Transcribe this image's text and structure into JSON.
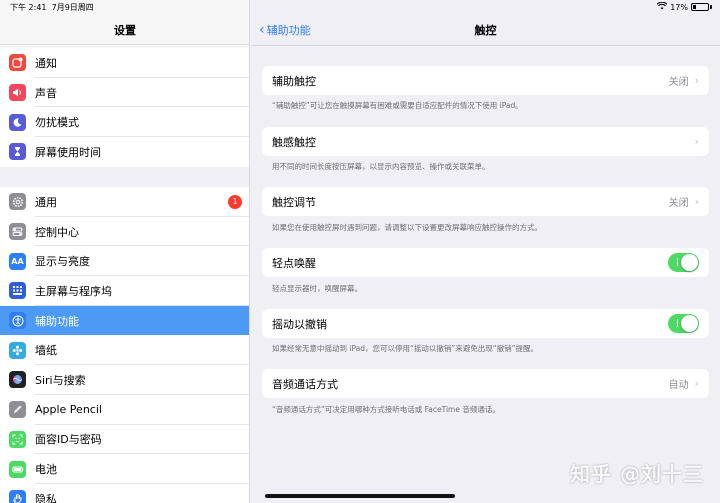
{
  "status": {
    "time": "下午 2:41",
    "date": "7月9日周四",
    "battery": "17%"
  },
  "sidebar": {
    "title": "设置",
    "group1": [
      {
        "label": "通知",
        "icon": "notifications-icon",
        "color": "#f0483e"
      },
      {
        "label": "声音",
        "icon": "sound-icon",
        "color": "#f0465e"
      },
      {
        "label": "勿扰模式",
        "icon": "moon-icon",
        "color": "#5a5ad6"
      },
      {
        "label": "屏幕使用时间",
        "icon": "hourglass-icon",
        "color": "#5a5ad6"
      }
    ],
    "group2": [
      {
        "label": "通用",
        "icon": "gear-icon",
        "color": "#8e8e93",
        "badge": "1"
      },
      {
        "label": "控制中心",
        "icon": "control-center-icon",
        "color": "#8e8e93"
      },
      {
        "label": "显示与亮度",
        "icon": "display-icon",
        "color": "#2f7ef6"
      },
      {
        "label": "主屏幕与程序坞",
        "icon": "home-screen-icon",
        "color": "#2f5fd6"
      },
      {
        "label": "辅助功能",
        "icon": "accessibility-icon",
        "color": "#2f7ef6",
        "selected": true
      },
      {
        "label": "墙纸",
        "icon": "wallpaper-icon",
        "color": "#35aadc"
      },
      {
        "label": "Siri与搜索",
        "icon": "siri-icon",
        "color": "#222222"
      },
      {
        "label": "Apple Pencil",
        "icon": "pencil-icon",
        "color": "#8e8e93"
      },
      {
        "label": "面容ID与密码",
        "icon": "face-id-icon",
        "color": "#4cd964"
      },
      {
        "label": "电池",
        "icon": "battery-icon",
        "color": "#4cd964"
      },
      {
        "label": "隐私",
        "icon": "privacy-hand-icon",
        "color": "#2f7ef6"
      }
    ]
  },
  "nav": {
    "back_label": "辅助功能",
    "title": "触控"
  },
  "settings": [
    {
      "label": "辅助触控",
      "value": "关闭",
      "type": "disclosure",
      "footer": "“辅助触控”可让您在触摸屏幕有困难或需要自适应配件的情况下使用 iPad。"
    },
    {
      "label": "触感触控",
      "value": "",
      "type": "disclosure",
      "footer": "用不同的时间长度按压屏幕，以显示内容预览、操作或关联菜单。"
    },
    {
      "label": "触控调节",
      "value": "关闭",
      "type": "disclosure",
      "footer": "如果您在使用触控屏时遇到问题，请调整以下设置更改屏幕响应触控操作的方式。"
    },
    {
      "label": "轻点唤醒",
      "value": "",
      "type": "toggle",
      "on": true,
      "footer": "轻点显示器时，唤醒屏幕。"
    },
    {
      "label": "摇动以撤销",
      "value": "",
      "type": "toggle",
      "on": true,
      "footer": "如果经常无意中摇动到 iPad，您可以停用“摇动以撤销”来避免出现“撤销”提醒。"
    },
    {
      "label": "音频通话方式",
      "value": "自动",
      "type": "disclosure",
      "footer": "“音频通话方式”可决定用哪种方式接听电话或 FaceTime 音频通话。"
    }
  ],
  "watermark": "知乎 @刘十三",
  "colors": {
    "accent": "#2f7ef6",
    "toggle_on": "#4cd964",
    "selected_row": "#4d9af4"
  }
}
